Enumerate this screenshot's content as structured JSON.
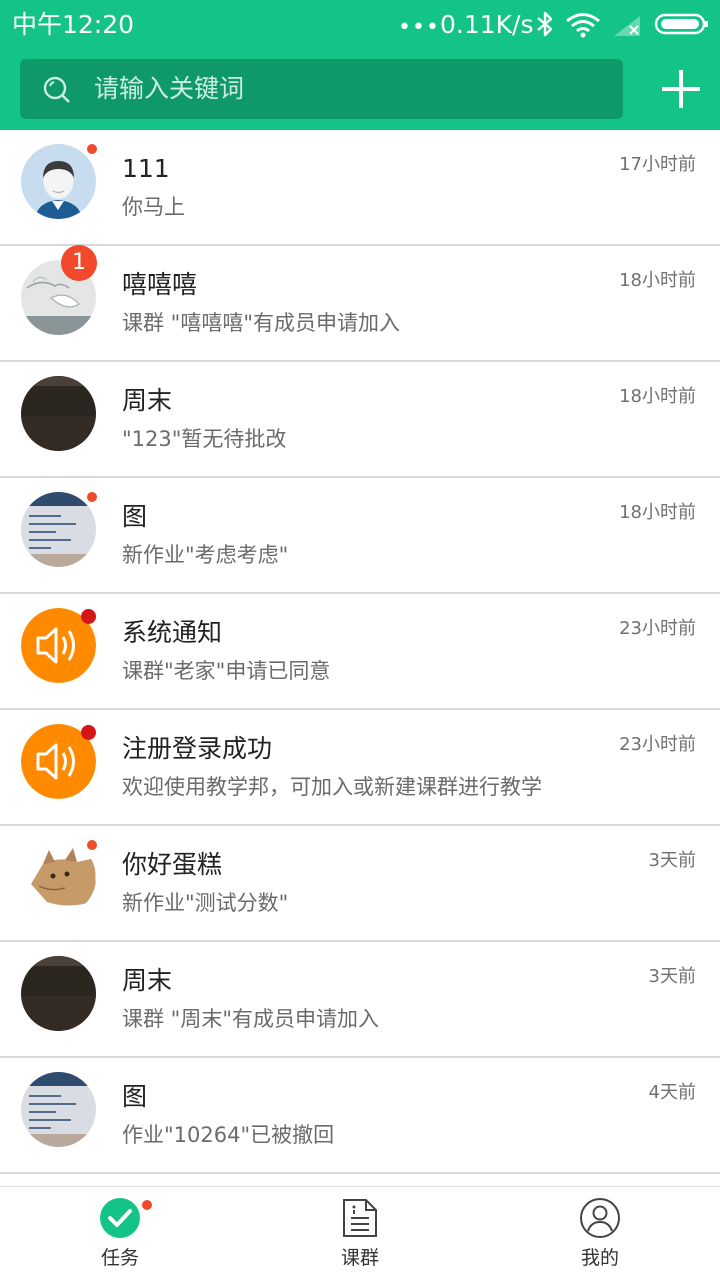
{
  "status_bar": {
    "time": "中午12:20",
    "dots": "•••",
    "speed": "0.11K/s"
  },
  "search": {
    "placeholder": "请输入关键词"
  },
  "conversations": [
    {
      "title": "111",
      "preview": "你马上",
      "time": "17小时前",
      "avatar": "person-avatar",
      "unread_dot": true
    },
    {
      "title": "嘻嘻嘻",
      "preview": "课群 \"嘻嘻嘻\"有成员申请加入",
      "time": "18小时前",
      "avatar": "bird-sketch-avatar",
      "badge": "1"
    },
    {
      "title": "周末",
      "preview": "\"123\"暂无待批改",
      "time": "18小时前",
      "avatar": "dark-photo-avatar"
    },
    {
      "title": "图",
      "preview": "新作业\"考虑考虑\"",
      "time": "18小时前",
      "avatar": "screen-photo-avatar",
      "unread_dot": true
    },
    {
      "title": "系统通知",
      "preview": "课群\"老家\"申请已同意",
      "time": "23小时前",
      "avatar": "speaker-icon",
      "unread_dot": true
    },
    {
      "title": "注册登录成功",
      "preview": "欢迎使用教学邦，可加入或新建课群进行教学",
      "time": "23小时前",
      "avatar": "speaker-icon",
      "unread_dot": true
    },
    {
      "title": "你好蛋糕",
      "preview": "新作业\"测试分数\"",
      "time": "3天前",
      "avatar": "cat-photo-avatar",
      "unread_dot": true
    },
    {
      "title": "周末",
      "preview": "课群 \"周末\"有成员申请加入",
      "time": "3天前",
      "avatar": "dark-photo-avatar"
    },
    {
      "title": "图",
      "preview": "作业\"10264\"已被撤回",
      "time": "4天前",
      "avatar": "screen-photo-avatar"
    }
  ],
  "tabs": [
    {
      "label": "任务",
      "icon": "check-circle-icon",
      "active": true
    },
    {
      "label": "课群",
      "icon": "document-icon"
    },
    {
      "label": "我的",
      "icon": "user-circle-icon"
    }
  ],
  "colors": {
    "primary": "#14c487",
    "search_bg": "#0f9868",
    "notify_orange": "#ff8a00",
    "unread_red": "#f0492b"
  }
}
